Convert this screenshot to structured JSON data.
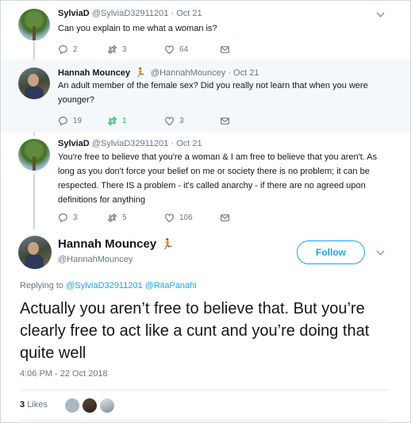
{
  "tweets": [
    {
      "name": "SylviaD",
      "handle": "@SylviaD32911201",
      "dot": "·",
      "date": "Oct 21",
      "text": "Can you explain to me what a woman is?",
      "replies": "2",
      "retweets": "3",
      "likes": "64"
    },
    {
      "name": "Hannah Mouncey",
      "handle": "@HannahMouncey",
      "dot": "·",
      "date": "Oct 21",
      "text": "An adult member of the female sex? Did you really not learn that when you were younger?",
      "replies": "19",
      "retweets": "1",
      "likes": "3"
    },
    {
      "name": "SylviaD",
      "handle": "@SylviaD32911201",
      "dot": "·",
      "date": "Oct 21",
      "text": "You're free to believe that you're a woman & I am free to believe that you aren't. As long as you don't force your belief on me or society there is no problem; it can be respected. There IS a problem - it's called anarchy - if there are no agreed upon definitions for anything",
      "replies": "3",
      "retweets": "5",
      "likes": "106"
    }
  ],
  "main": {
    "name": "Hannah Mouncey",
    "handle": "@HannahMouncey",
    "follow_label": "Follow",
    "replying_prefix": "Replying to",
    "replying_to_1": "@SylviaD32911201",
    "replying_to_2": "@RitaPanahi",
    "text": "Actually you aren’t free to believe that. But you’re clearly free to act like a cunt and you’re doing that quite well",
    "timestamp": "4:06 PM - 22 Oct 2018",
    "likes_count": "3",
    "likes_label": "Likes"
  },
  "icons": {
    "reply": "reply-icon",
    "retweet": "retweet-icon",
    "like": "heart-icon",
    "dm": "envelope-icon",
    "caret": "chevron-down-icon",
    "emoji": "running-woman-emoji"
  },
  "colors": {
    "accent": "#1da1f2",
    "retweet_active": "#17bf63",
    "muted": "#657786",
    "highlight_bg": "#f5f8fa"
  }
}
